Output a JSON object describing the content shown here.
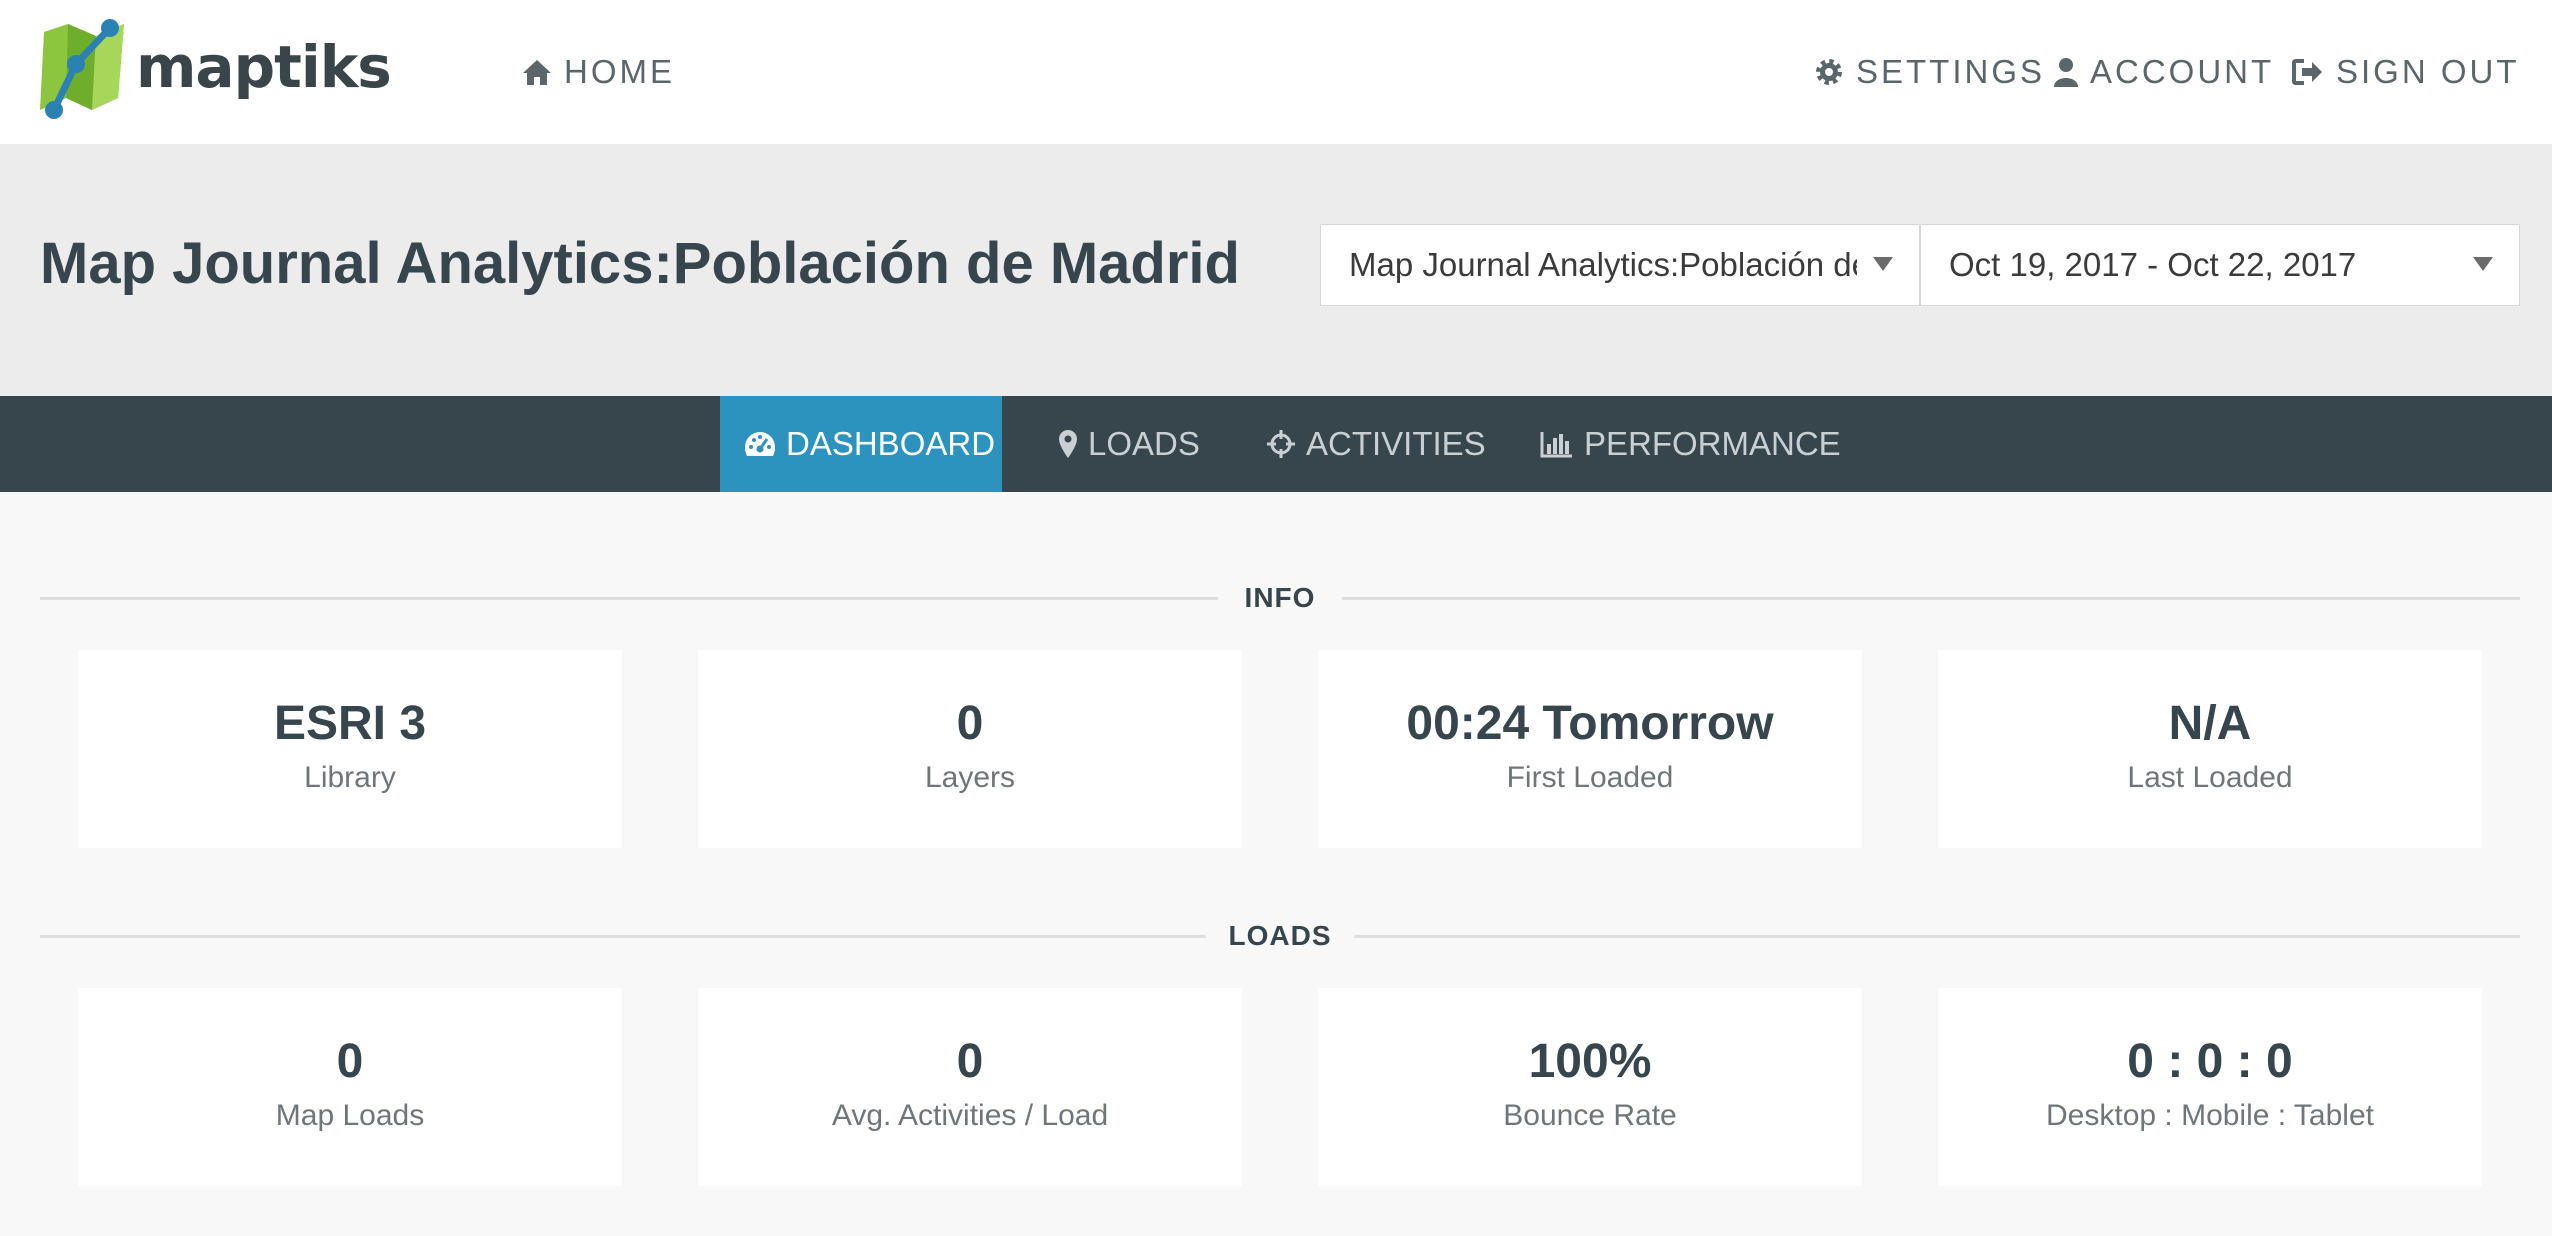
{
  "brand": {
    "name": "maptiks"
  },
  "nav": {
    "home": "HOME",
    "settings": "SETTINGS",
    "account": "ACCOUNT",
    "sign_out": "SIGN OUT"
  },
  "header": {
    "title": "Map Journal Analytics:Población de Madrid",
    "map_select": "Map Journal Analytics:Población de Madrid",
    "date_range": "Oct 19, 2017 - Oct 22, 2017"
  },
  "tabs": [
    {
      "label": "DASHBOARD",
      "icon": "dashboard-icon",
      "active": true
    },
    {
      "label": "LOADS",
      "icon": "map-marker-icon",
      "active": false
    },
    {
      "label": "ACTIVITIES",
      "icon": "crosshairs-icon",
      "active": false
    },
    {
      "label": "PERFORMANCE",
      "icon": "bar-chart-icon",
      "active": false
    }
  ],
  "sections": {
    "info": {
      "title": "INFO",
      "cards": [
        {
          "value": "ESRI 3",
          "label": "Library"
        },
        {
          "value": "0",
          "label": "Layers"
        },
        {
          "value": "00:24 Tomorrow",
          "label": "First Loaded"
        },
        {
          "value": "N/A",
          "label": "Last Loaded"
        }
      ]
    },
    "loads": {
      "title": "LOADS",
      "cards": [
        {
          "value": "0",
          "label": "Map Loads"
        },
        {
          "value": "0",
          "label": "Avg. Activities / Load"
        },
        {
          "value": "100%",
          "label": "Bounce Rate"
        },
        {
          "value": "0 : 0 : 0",
          "label": "Desktop : Mobile : Tablet"
        }
      ]
    }
  },
  "colors": {
    "accent": "#2b93bd",
    "tabbar": "#37454d",
    "header_band": "#ececec",
    "logo_green": "#8cc63f"
  }
}
